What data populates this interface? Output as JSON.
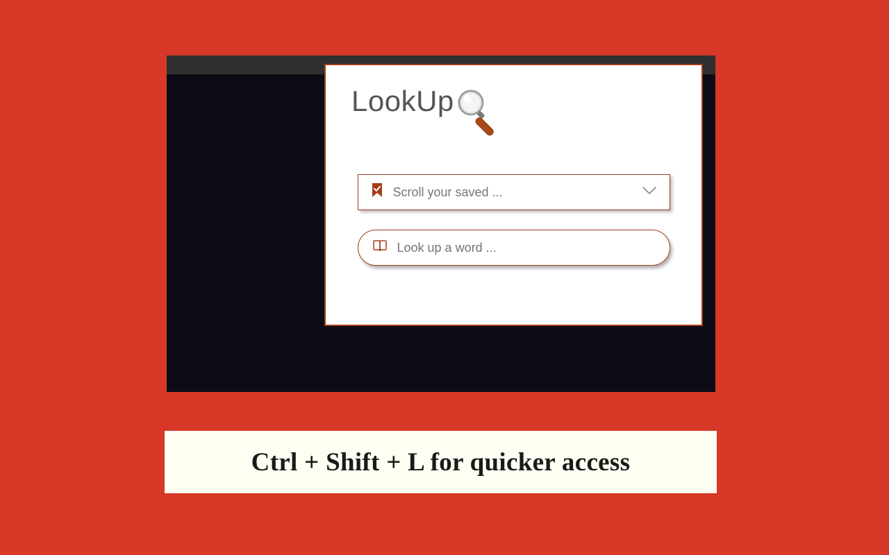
{
  "app": {
    "title": "LookUp"
  },
  "dropdown": {
    "placeholder": "Scroll your saved ..."
  },
  "search": {
    "placeholder": "Look up a word ..."
  },
  "tip": {
    "text": "Ctrl + Shift + L for quicker access"
  },
  "colors": {
    "background": "#d73827",
    "accent": "#a33d17"
  }
}
